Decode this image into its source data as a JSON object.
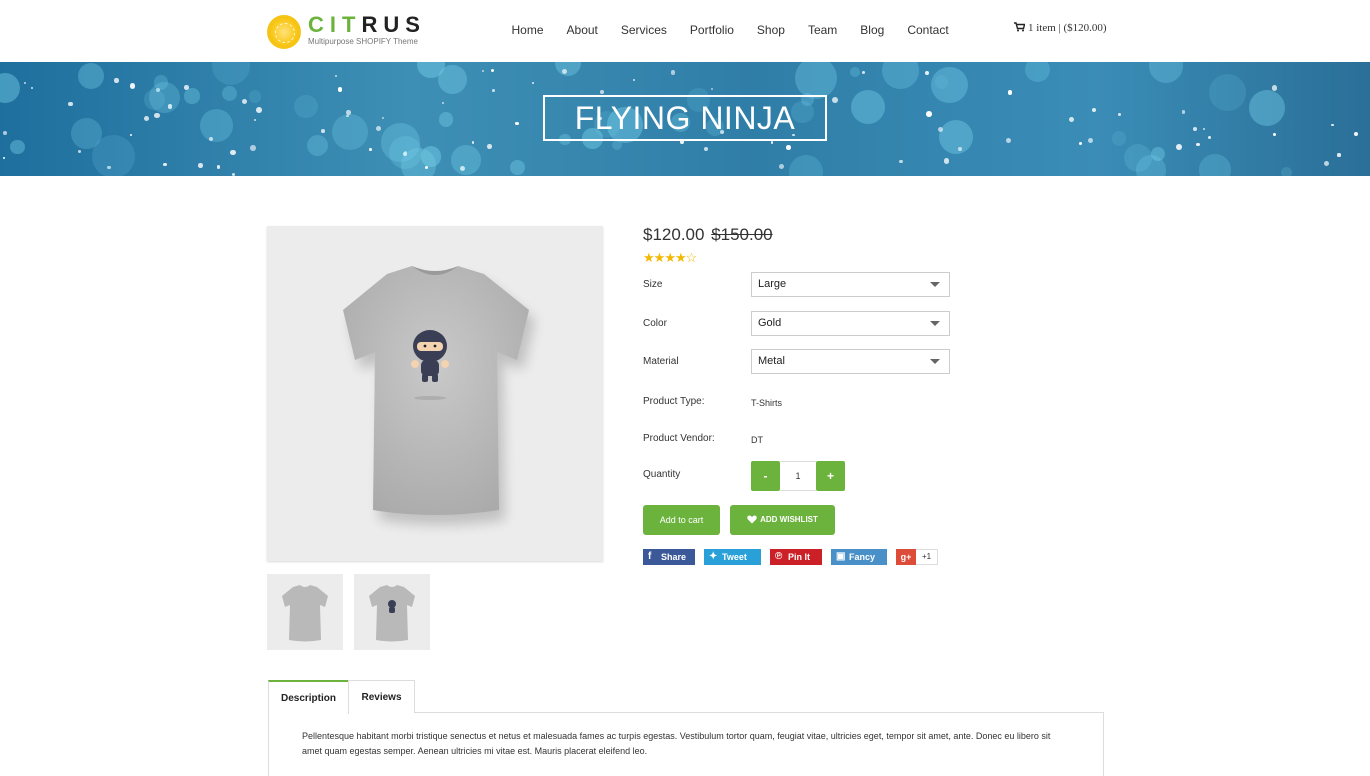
{
  "brand": {
    "name_part1": "CIT",
    "name_part2": "RUS",
    "tagline": "Multipurpose SHOPIFY Theme",
    "accent_color": "#6cb33e",
    "logo_icon": "lemon-slice-icon"
  },
  "nav": {
    "items": [
      "Home",
      "About",
      "Services",
      "Portfolio",
      "Shop",
      "Team",
      "Blog",
      "Contact"
    ]
  },
  "cart": {
    "icon": "cart-icon",
    "summary": "1 item | ($120.00)"
  },
  "banner": {
    "title": "FLYING NINJA"
  },
  "product": {
    "price": "$120.00",
    "old_price": "$150.00",
    "rating": {
      "value": 4,
      "max": 5
    },
    "options": [
      {
        "label": "Size",
        "value": "Large"
      },
      {
        "label": "Color",
        "value": "Gold"
      },
      {
        "label": "Material",
        "value": "Metal"
      }
    ],
    "type_label": "Product Type:",
    "type_value": "T-Shirts",
    "vendor_label": "Product Vendor:",
    "vendor_value": "DT",
    "quantity_label": "Quantity",
    "quantity_value": "1",
    "minus_label": "-",
    "plus_label": "+",
    "add_to_cart_label": "Add to cart",
    "wishlist_label": "ADD WISHLIST"
  },
  "share": {
    "facebook": "Share",
    "twitter": "Tweet",
    "pinterest": "Pin It",
    "fancy": "Fancy",
    "gplus_icon": "g+",
    "gplus_count": "+1"
  },
  "tabs": {
    "items": [
      "Description",
      "Reviews"
    ],
    "active": "Description",
    "description_text": "Pellentesque habitant morbi tristique senectus et netus et malesuada fames ac turpis egestas. Vestibulum tortor quam, feugiat vitae, ultricies eget, tempor sit amet, ante. Donec eu libero sit amet quam egestas semper. Aenean ultricies mi vitae est. Mauris placerat eleifend leo."
  }
}
